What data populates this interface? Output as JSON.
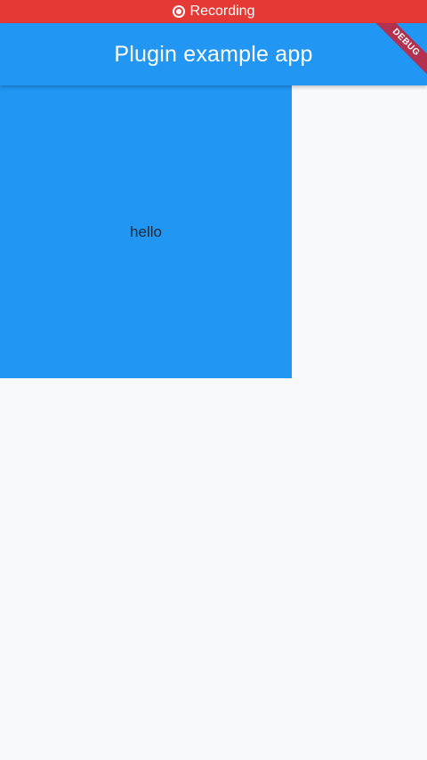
{
  "status_bar": {
    "label": "Recording",
    "icon": "record-icon",
    "color": "#e53935"
  },
  "app_bar": {
    "title": "Plugin example app",
    "color": "#2196f3"
  },
  "debug_banner": {
    "label": "DEBUG"
  },
  "content": {
    "box_text": "hello",
    "box_color": "#2196f3"
  }
}
